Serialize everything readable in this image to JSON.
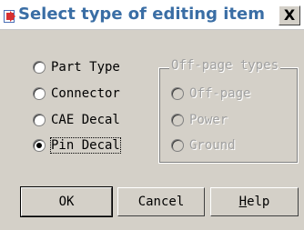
{
  "dialog": {
    "title": "Select type of editing item",
    "close_label": "X"
  },
  "options": [
    {
      "label": "Part Type",
      "checked": false
    },
    {
      "label": "Connector",
      "checked": false
    },
    {
      "label": "CAE Decal",
      "checked": false
    },
    {
      "label": "Pin Decal",
      "checked": true
    }
  ],
  "off_page": {
    "title": "Off-page types",
    "items": [
      {
        "label": "Off-page"
      },
      {
        "label": "Power"
      },
      {
        "label": "Ground"
      }
    ]
  },
  "buttons": {
    "ok": "OK",
    "cancel": "Cancel",
    "help_mnemonic": "H",
    "help_rest": "elp"
  }
}
